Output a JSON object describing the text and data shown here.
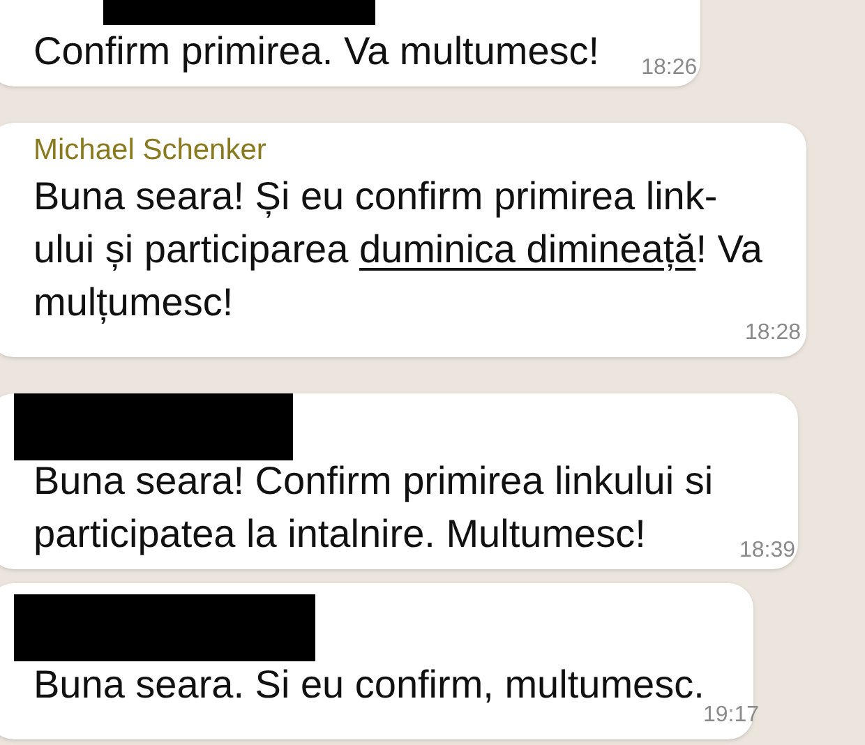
{
  "messages": [
    {
      "sender": {
        "kind": "redacted"
      },
      "parts": [
        {
          "text": "Confirm primirea. Va multumesc!",
          "underlined": false
        }
      ],
      "time": "18:26"
    },
    {
      "sender": {
        "kind": "name",
        "text": "Michael Schenker"
      },
      "parts": [
        {
          "text": "Buna seara! Și eu confirm primirea link-ului și participarea ",
          "underlined": false
        },
        {
          "text": "duminica dimineață",
          "underlined": true
        },
        {
          "text": "! Va mulțumesc!",
          "underlined": false
        }
      ],
      "time": "18:28"
    },
    {
      "sender": {
        "kind": "redacted"
      },
      "parts": [
        {
          "text": "Buna seara! Confirm primirea linkului si participatea la intalnire. Multumesc!",
          "underlined": false
        }
      ],
      "time": "18:39"
    },
    {
      "sender": {
        "kind": "redacted"
      },
      "parts": [
        {
          "text": "Buna seara. Si eu confirm, multumesc.",
          "underlined": false
        }
      ],
      "time": "19:17"
    }
  ]
}
